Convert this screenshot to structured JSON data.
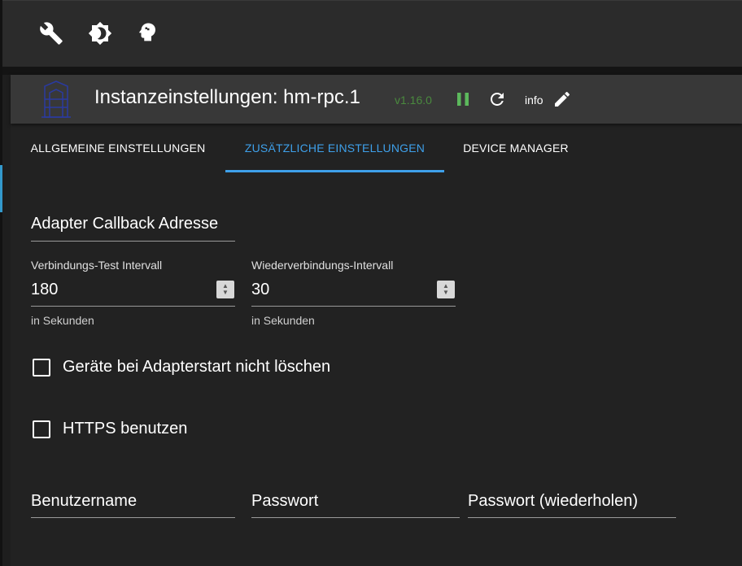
{
  "toolbar": {
    "icons": [
      "wrench-icon",
      "brightness-icon",
      "expert-mode-icon"
    ]
  },
  "dialog": {
    "title": "Instanzeinstellungen: hm-rpc.1",
    "version": "v1.16.0",
    "info_label": "info",
    "version_color": "#4a8a3e",
    "pause_color": "#5cb85c"
  },
  "tabs": [
    {
      "label": "Allgemeine Einstellungen",
      "active": false
    },
    {
      "label": "Zusätzliche Einstellungen",
      "active": true
    },
    {
      "label": "Device Manager",
      "active": false
    }
  ],
  "form": {
    "callback_address": {
      "placeholder": "Adapter Callback Adresse",
      "value": ""
    },
    "check_interval": {
      "label": "Verbindungs-Test Intervall",
      "value": "180",
      "helper": "in Sekunden"
    },
    "reconnect_interval": {
      "label": "Wiederverbindungs-Intervall",
      "value": "30",
      "helper": "in Sekunden"
    },
    "dont_delete_devices": {
      "label": "Geräte bei Adapterstart nicht löschen",
      "checked": false
    },
    "use_https": {
      "label": "HTTPS benutzen",
      "checked": false
    },
    "username": {
      "placeholder": "Benutzername",
      "value": ""
    },
    "password": {
      "placeholder": "Passwort",
      "value": ""
    },
    "password_repeat": {
      "placeholder": "Passwort (wiederholen)",
      "value": ""
    }
  },
  "colors": {
    "accent": "#3ea0ea",
    "background": "#222222",
    "header": "#383838"
  }
}
